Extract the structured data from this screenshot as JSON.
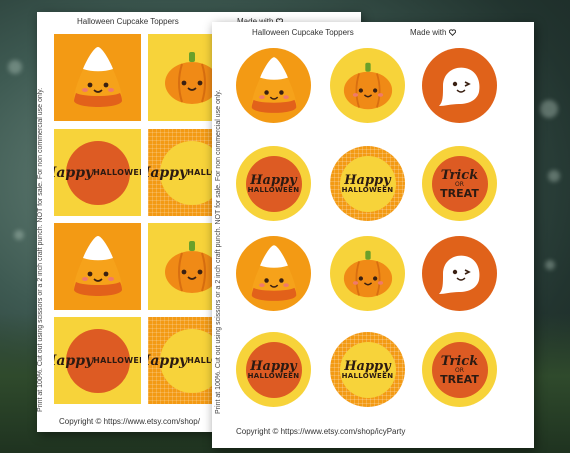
{
  "background": {
    "scene": "blurred green grass with bokeh",
    "colors": {
      "grass": "#2f4a2c",
      "bokeh": "#c8dcd2"
    }
  },
  "colors": {
    "orange": "#f39a14",
    "yellow": "#f7d33a",
    "dark_orange": "#e0621a",
    "red_orange": "#dd5b23",
    "text_dark": "#2b1a12"
  },
  "back_sheet": {
    "title": "Halloween Cupcake Toppers",
    "made_with": "Made with",
    "heart_icon": "heart-outline-icon",
    "side_note": "Print at 100%. Cut out using scissors or a 2 inch craft punch. NOT for sale. For non commercial use only.",
    "copyright": "Copyright © https://www.etsy.com/shop/",
    "toppers": [
      {
        "kind": "candy-corn",
        "bg": "orange"
      },
      {
        "kind": "pumpkin",
        "bg": "yellow"
      },
      {
        "kind": "happy-halloween",
        "bg": "yellow",
        "line1": "Happy",
        "line2": "HALLOWEEN"
      },
      {
        "kind": "happy-halloween",
        "bg": "checkered",
        "line1": "Happy",
        "line2": "HALLOWEEN"
      },
      {
        "kind": "candy-corn",
        "bg": "orange"
      },
      {
        "kind": "pumpkin",
        "bg": "yellow"
      },
      {
        "kind": "happy-halloween",
        "bg": "yellow",
        "line1": "Happy",
        "line2": "HALLOWEEN"
      },
      {
        "kind": "happy-halloween",
        "bg": "checkered",
        "line1": "Happy",
        "line2": "HALLOWEEN"
      }
    ]
  },
  "front_sheet": {
    "title": "Halloween Cupcake Toppers",
    "made_with": "Made with",
    "heart_icon": "heart-outline-icon",
    "side_note": "Print at 100%. Cut out using scissors or a 2 inch craft punch. NOT for sale. For non commercial use only.",
    "copyright": "Copyright © https://www.etsy.com/shop/icyParty",
    "toppers": [
      {
        "kind": "candy-corn",
        "bg": "orange"
      },
      {
        "kind": "pumpkin",
        "bg": "yellow"
      },
      {
        "kind": "ghost",
        "bg": "dark-orange"
      },
      {
        "kind": "happy-halloween",
        "bg": "yellow",
        "line1": "Happy",
        "line2": "HALLOWEEN"
      },
      {
        "kind": "happy-halloween",
        "bg": "checkered",
        "line1": "Happy",
        "line2": "HALLOWEEN"
      },
      {
        "kind": "trick-or-treat",
        "bg": "dark-orange",
        "line1": "Trick",
        "line2": "OR",
        "line3": "TREAT"
      },
      {
        "kind": "candy-corn",
        "bg": "orange"
      },
      {
        "kind": "pumpkin",
        "bg": "yellow"
      },
      {
        "kind": "ghost",
        "bg": "dark-orange"
      },
      {
        "kind": "happy-halloween",
        "bg": "yellow",
        "line1": "Happy",
        "line2": "HALLOWEEN"
      },
      {
        "kind": "happy-halloween",
        "bg": "checkered",
        "line1": "Happy",
        "line2": "HALLOWEEN"
      },
      {
        "kind": "trick-or-treat",
        "bg": "dark-orange",
        "line1": "Trick",
        "line2": "OR",
        "line3": "TREAT"
      }
    ]
  }
}
